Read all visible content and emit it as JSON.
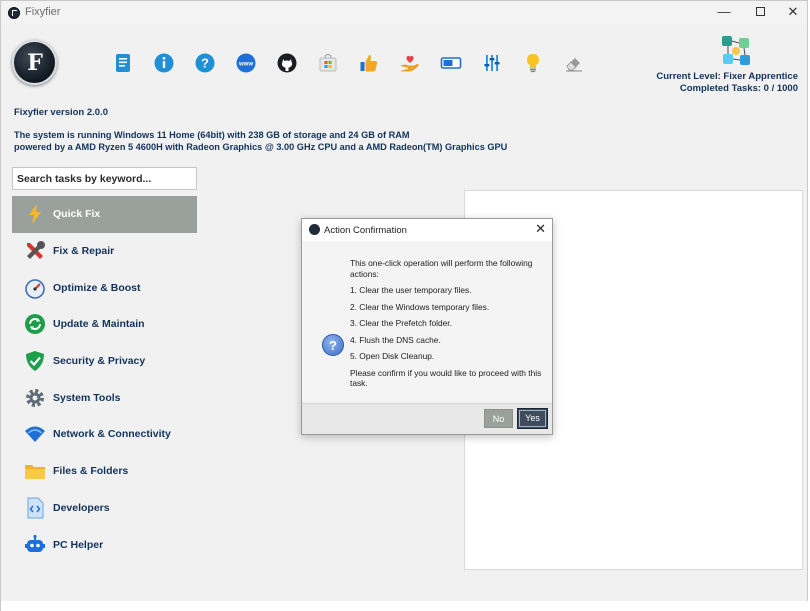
{
  "window": {
    "title": "Fixyfier"
  },
  "toolbar": {
    "icons": [
      "documentation-icon",
      "info-icon",
      "help-icon",
      "website-icon",
      "github-icon",
      "windows-store-icon",
      "thumbs-up-icon",
      "donate-icon",
      "toggle-icon",
      "settings-sliders-icon",
      "tips-lightbulb-icon",
      "eraser-icon"
    ]
  },
  "level": {
    "current": "Current Level: Fixer Apprentice",
    "completed": "Completed Tasks: 0 / 1000"
  },
  "system": {
    "version": "Fixyfier version 2.0.0",
    "line1": "The system is running Windows 11 Home (64bit) with 238 GB of storage and 24 GB of RAM",
    "line2": "powered by a AMD Ryzen 5 4600H with Radeon Graphics @ 3.00 GHz CPU and a AMD Radeon(TM) Graphics GPU"
  },
  "search": {
    "placeholder": "Search tasks by keyword..."
  },
  "sidebar": {
    "items": [
      {
        "label": "Quick Fix",
        "icon": "lightning-icon"
      },
      {
        "label": "Fix & Repair",
        "icon": "tools-icon"
      },
      {
        "label": "Optimize & Boost",
        "icon": "speedometer-icon"
      },
      {
        "label": "Update & Maintain",
        "icon": "refresh-icon"
      },
      {
        "label": "Security & Privacy",
        "icon": "shield-icon"
      },
      {
        "label": "System Tools",
        "icon": "gear-icon"
      },
      {
        "label": "Network & Connectivity",
        "icon": "wifi-icon"
      },
      {
        "label": "Files & Folders",
        "icon": "folder-icon"
      },
      {
        "label": "Developers",
        "icon": "code-file-icon"
      },
      {
        "label": "PC Helper",
        "icon": "robot-icon"
      }
    ]
  },
  "dialog": {
    "title": "Action Confirmation",
    "close": "✕",
    "intro": "This one-click operation will perform the following actions:",
    "steps": [
      "1. Clear the user temporary files.",
      "2. Clear the Windows temporary files.",
      "3. Clear the Prefetch folder.",
      "4. Flush the DNS cache.",
      "5. Open Disk Cleanup."
    ],
    "outro": "Please confirm if you would like to proceed with this task.",
    "no_label": "No",
    "yes_label": "Yes"
  },
  "colors": {
    "accent_text": "#12335a",
    "active_item": "#9aa19c",
    "dialog_yes": "#3d4b5c"
  }
}
